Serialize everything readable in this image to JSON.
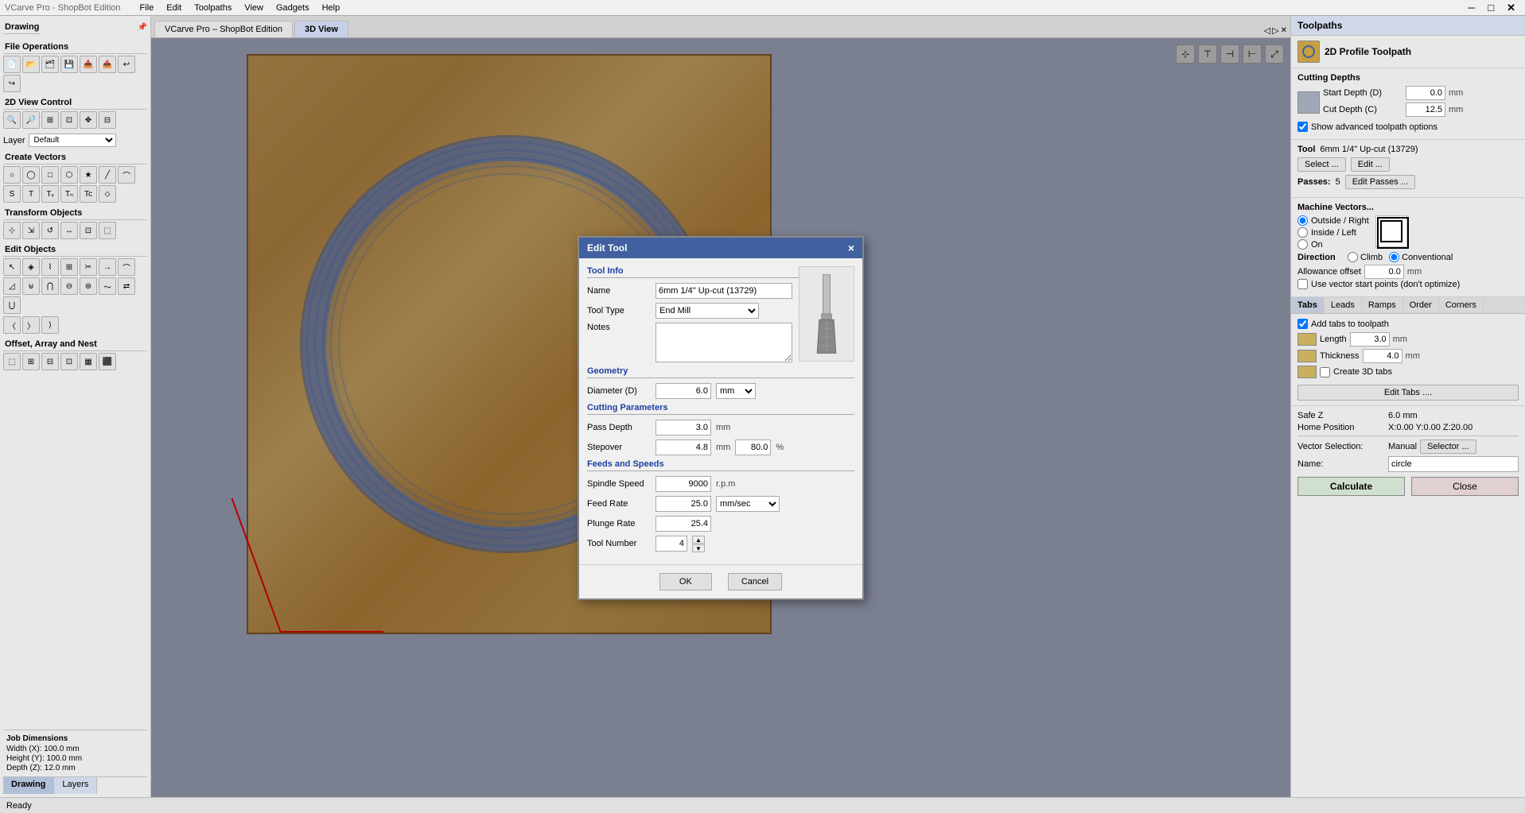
{
  "app": {
    "title": "VCarve Pro - ShopBot Edition",
    "tabs": [
      "VCarve Pro – ShopBot Edition",
      "3D View"
    ],
    "active_tab": "3D View",
    "status": "Ready"
  },
  "menu": {
    "items": [
      "File",
      "Edit",
      "Toolpaths",
      "View",
      "Gadgets",
      "Help"
    ]
  },
  "left_panel": {
    "drawing_label": "Drawing",
    "sections": [
      {
        "title": "File Operations"
      },
      {
        "title": "2D View Control"
      },
      {
        "title": "Create Vectors"
      },
      {
        "title": "Transform Objects"
      },
      {
        "title": "Edit Objects"
      },
      {
        "title": "Offset, Array and Nest"
      }
    ],
    "layer_label": "Layer",
    "layer_value": "Default",
    "bottom_tabs": [
      "Drawing",
      "Layers"
    ]
  },
  "job_dimensions": {
    "title": "Job Dimensions",
    "width": "Width (X): 100.0 mm",
    "height": "Height (Y): 100.0 mm",
    "depth": "Depth (Z): 12.0 mm"
  },
  "canvas": {
    "toolbar_icons": [
      "iso-view",
      "top-view",
      "front-view",
      "side-view",
      "zoom-extents"
    ]
  },
  "right_panel": {
    "title": "Toolpaths",
    "section_title": "2D Profile Toolpath",
    "cutting_depths": {
      "label": "Cutting Depths",
      "start_depth_label": "Start Depth (D)",
      "start_depth_value": "0.0",
      "cut_depth_label": "Cut Depth (C)",
      "cut_depth_value": "12.5",
      "unit": "mm",
      "show_advanced_label": "Show advanced toolpath options"
    },
    "tool": {
      "label": "Tool",
      "name": "6mm 1/4\" Up-cut (13729)",
      "select_btn": "Select ...",
      "edit_btn": "Edit ..."
    },
    "passes": {
      "label": "Passes:",
      "value": "5",
      "edit_btn": "Edit Passes ..."
    },
    "machine_vectors": {
      "label": "Machine Vectors...",
      "options": [
        "Outside / Right",
        "Inside / Left",
        "On"
      ],
      "selected": "Outside / Right",
      "direction_label": "Direction",
      "direction_options": [
        "Climb",
        "Conventional"
      ],
      "direction_selected": "Conventional",
      "allowance_label": "Allowance offset",
      "allowance_value": "0.0",
      "unit": "mm",
      "use_vector_start_label": "Use vector start points (don't optimize)"
    },
    "tabs_strip": {
      "items": [
        "Tabs",
        "Leads",
        "Ramps",
        "Order",
        "Corners"
      ],
      "active": "Tabs"
    },
    "tabs_section": {
      "add_tabs_label": "Add tabs to toolpath",
      "add_tabs_checked": true,
      "length_label": "Length",
      "length_value": "3.0",
      "thickness_label": "Thickness",
      "thickness_value": "4.0",
      "unit": "mm",
      "create_3d_label": "Create 3D tabs",
      "edit_tabs_btn": "Edit Tabs ...."
    },
    "bottom": {
      "safe_z_label": "Safe Z",
      "safe_z_value": "6.0 mm",
      "home_position_label": "Home Position",
      "home_position_value": "X:0.00 Y:0.00 Z:20.00",
      "vector_selection_label": "Vector Selection:",
      "vector_selection_value": "Manual",
      "selector_btn": "Selector ...",
      "name_label": "Name:",
      "name_value": "circle",
      "calculate_btn": "Calculate",
      "close_btn": "Close"
    }
  },
  "modal": {
    "title": "Edit Tool",
    "close_icon": "×",
    "tool_info": {
      "section_title": "Tool Info",
      "name_label": "Name",
      "name_value": "6mm 1/4\" Up-cut (13729)",
      "tool_type_label": "Tool Type",
      "tool_type_value": "End Mill",
      "notes_label": "Notes",
      "notes_value": ""
    },
    "geometry": {
      "section_title": "Geometry",
      "diameter_label": "Diameter (D)",
      "diameter_value": "6.0",
      "unit_value": "mm"
    },
    "cutting_parameters": {
      "section_title": "Cutting Parameters",
      "pass_depth_label": "Pass Depth",
      "pass_depth_value": "3.0",
      "pass_depth_unit": "mm",
      "stepover_label": "Stepover",
      "stepover_value": "4.8",
      "stepover_unit": "mm",
      "stepover_pct": "80.0",
      "stepover_pct_unit": "%"
    },
    "feeds_and_speeds": {
      "section_title": "Feeds and Speeds",
      "spindle_speed_label": "Spindle Speed",
      "spindle_speed_value": "9000",
      "spindle_speed_unit": "r.p.m",
      "feed_rate_label": "Feed Rate",
      "feed_rate_value": "25.0",
      "plunge_rate_label": "Plunge Rate",
      "plunge_rate_value": "25.4",
      "rate_unit": "mm/sec"
    },
    "tool_number": {
      "label": "Tool Number",
      "value": "4"
    },
    "ok_btn": "OK",
    "cancel_btn": "Cancel"
  }
}
